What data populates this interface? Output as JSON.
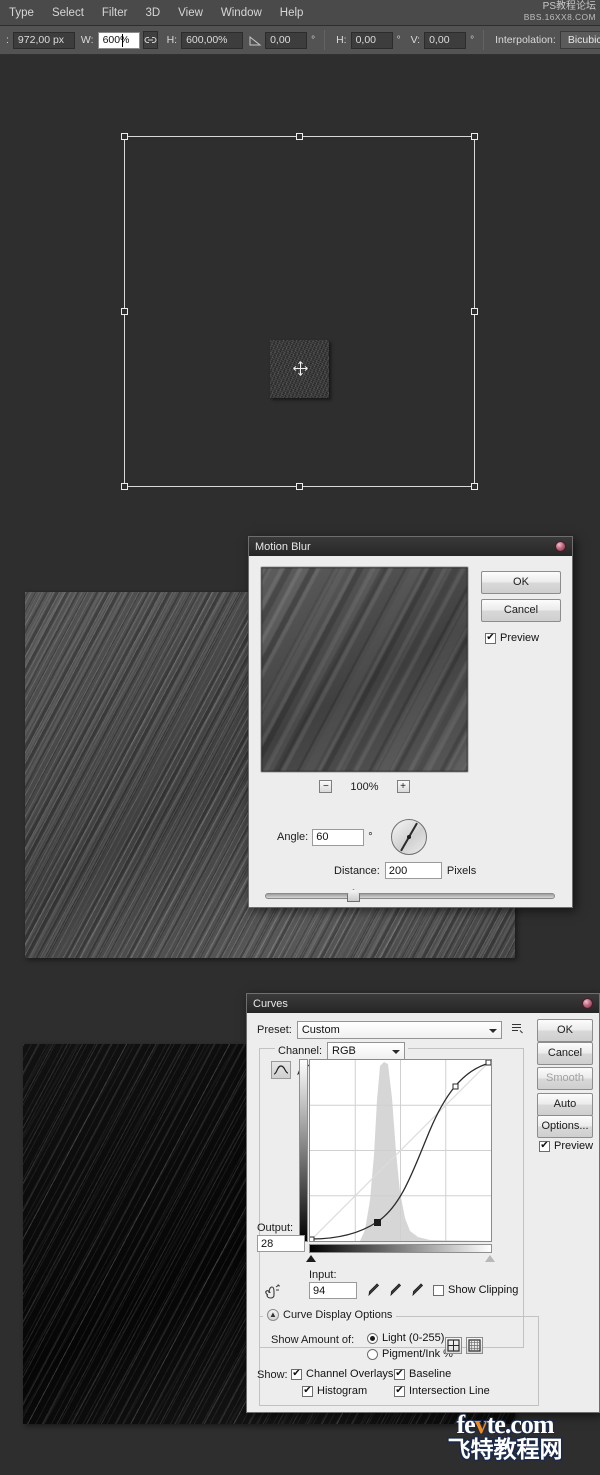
{
  "menubar": {
    "items": [
      {
        "label": "Type"
      },
      {
        "label": "Select"
      },
      {
        "label": "Filter"
      },
      {
        "label": "3D"
      },
      {
        "label": "View"
      },
      {
        "label": "Window"
      },
      {
        "label": "Help"
      }
    ],
    "brand_line1": "PS教程论坛",
    "brand_line2": "BBS.16XX8.COM"
  },
  "options_bar": {
    "height_value": "972,00 px",
    "w_label": "W:",
    "w_value": "600%",
    "link_icon": "link-chain-icon",
    "h_label": "H:",
    "h_value": "600,00%",
    "skew_icon": "skew-angle-icon",
    "angle_value": "0,00",
    "degree_symbol": "°",
    "hshear_label": "H:",
    "hshear_value": "0,00",
    "vshear_label": "V:",
    "vshear_value": "0,00",
    "interpolation_label": "Interpolation:",
    "interpolation_value": "Bicubic"
  },
  "canvas": {
    "transform_box_name": "free-transform-bounding-box",
    "thumbnail_name": "noise-layer-thumbnail",
    "cursor_name": "move-cursor"
  },
  "motion_blur": {
    "title": "Motion Blur",
    "ok": "OK",
    "cancel": "Cancel",
    "preview_label": "Preview",
    "preview_checked": "✔",
    "zoom_out": "−",
    "zoom_level": "100%",
    "zoom_in": "+",
    "angle_label": "Angle:",
    "angle_value": "60",
    "angle_degree": "°",
    "distance_label": "Distance:",
    "distance_value": "200",
    "distance_unit": "Pixels"
  },
  "curves": {
    "title": "Curves",
    "preset_label": "Preset:",
    "preset_value": "Custom",
    "preset_menu_icon": "preset-menu-icon",
    "channel_label": "Channel:",
    "channel_value": "RGB",
    "curve_tool_icon": "curve-pencil-icon",
    "pencil_tool_icon": "pencil-icon",
    "output_label": "Output:",
    "output_value": "28",
    "input_label": "Input:",
    "input_value": "94",
    "smooth_hand_icon": "on-image-adjust-icon",
    "eyedropper_black_icon": "eyedropper-black-point-icon",
    "eyedropper_gray_icon": "eyedropper-gray-point-icon",
    "eyedropper_white_icon": "eyedropper-white-point-icon",
    "show_clipping_label": "Show Clipping",
    "show_clipping_checked": false,
    "curve_display_options": "Curve Display Options",
    "collapse_icon": "collapse-chevron-icon",
    "show_amount_label": "Show Amount of:",
    "radio_light": "Light  (0-255)",
    "radio_pigment": "Pigment/Ink %",
    "radio_selected": "light",
    "grid_coarse_icon": "grid-quarter-icon",
    "grid_fine_icon": "grid-tenth-icon",
    "show_label": "Show:",
    "chk_channel_overlays": "Channel Overlays",
    "chk_baseline": "Baseline",
    "chk_histogram": "Histogram",
    "chk_intersection_line": "Intersection Line",
    "checked_mark": "✔",
    "buttons": {
      "ok": "OK",
      "cancel": "Cancel",
      "smooth": "Smooth",
      "auto": "Auto",
      "options": "Options...",
      "preview": "Preview"
    }
  },
  "watermark": {
    "line1_a": "fe",
    "line1_b": "v",
    "line1_c": "te.com",
    "line2": "飞特教程网"
  }
}
